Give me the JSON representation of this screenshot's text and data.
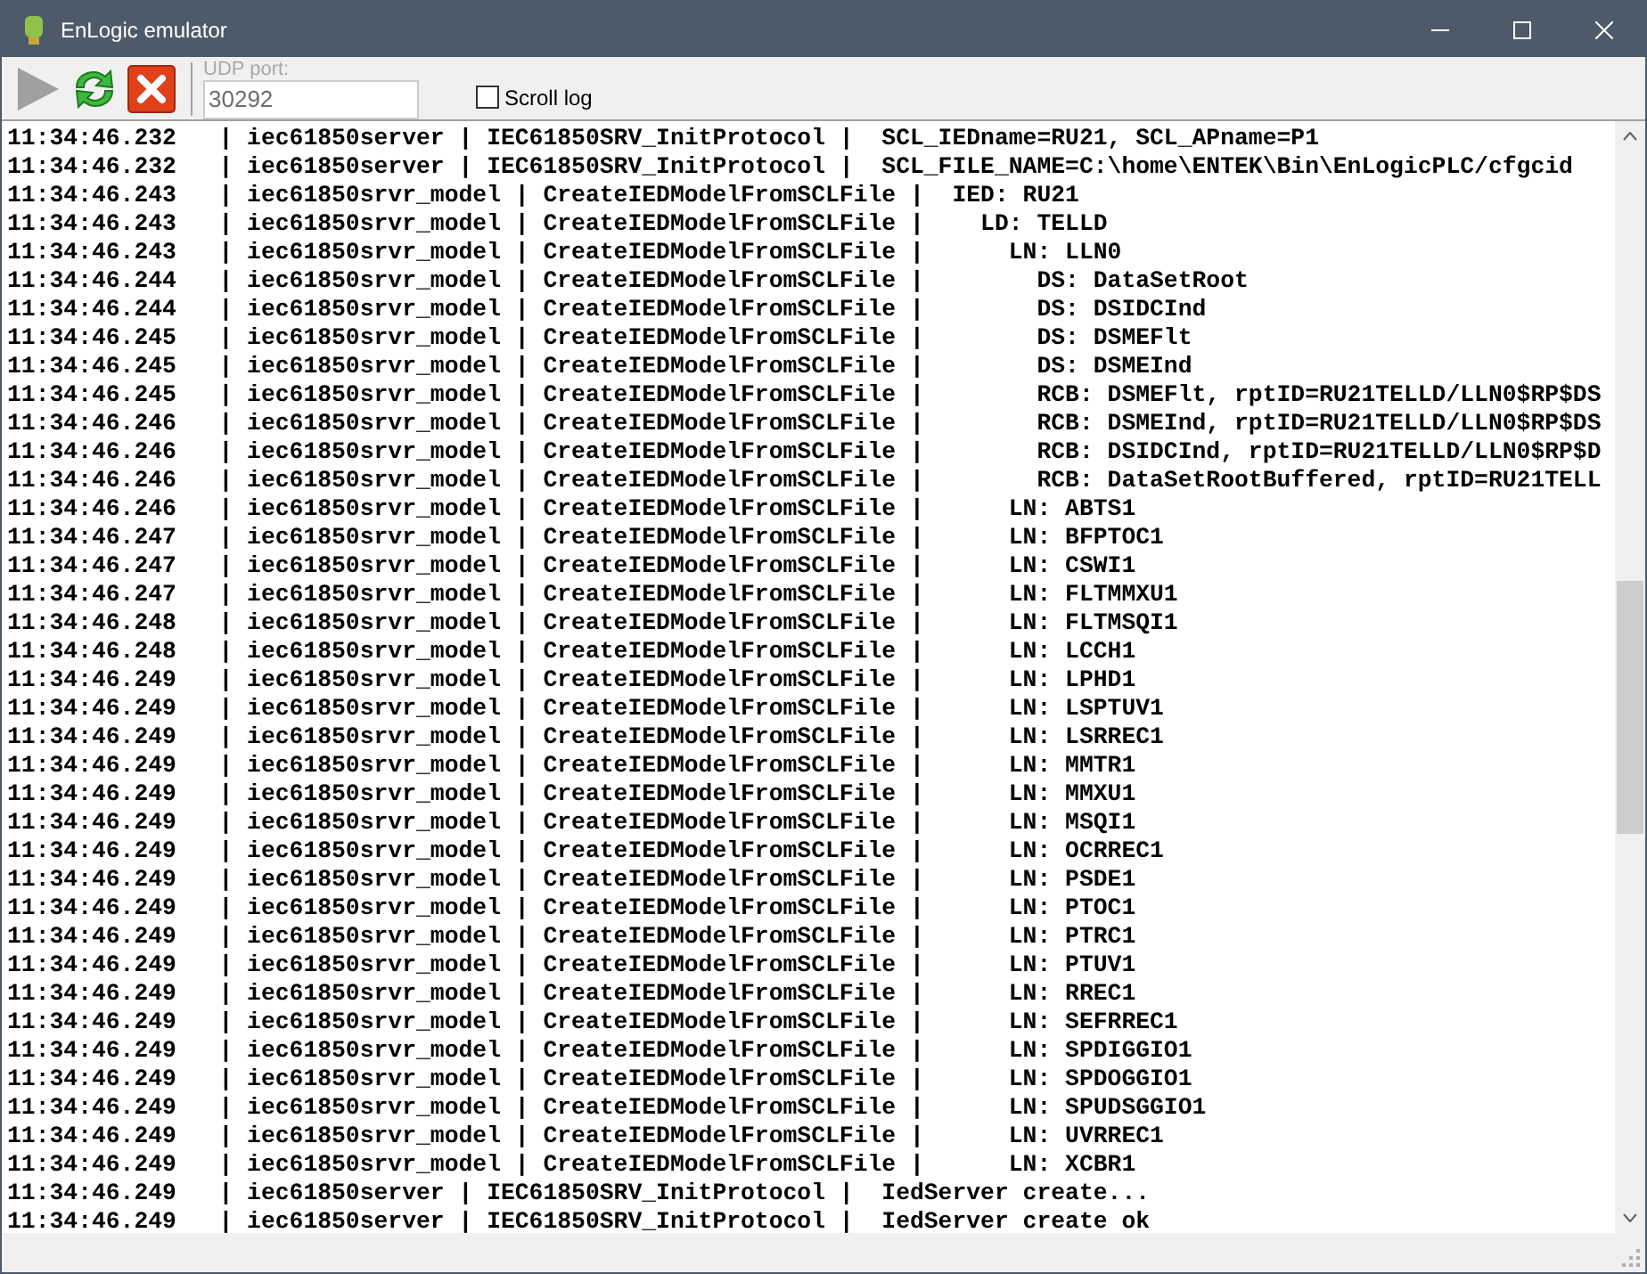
{
  "window": {
    "title": "EnLogic emulator"
  },
  "toolbar": {
    "buttons": [
      {
        "kind": "play",
        "disabled": true
      },
      {
        "kind": "refresh",
        "disabled": false
      },
      {
        "kind": "stop",
        "disabled": false
      }
    ],
    "udp_port": {
      "label": "UDP port:",
      "value": "30292",
      "disabled": true
    },
    "scroll_log": {
      "label": "Scroll log",
      "checked": false
    }
  },
  "log": [
    "11:34:46.232   | iec61850server | IEC61850SRV_InitProtocol |  SCL_IEDname=RU21, SCL_APname=P1",
    "11:34:46.232   | iec61850server | IEC61850SRV_InitProtocol |  SCL_FILE_NAME=C:\\home\\ENTEK\\Bin\\EnLogicPLC/cfgcid",
    "11:34:46.243   | iec61850srvr_model | CreateIEDModelFromSCLFile |  IED: RU21",
    "11:34:46.243   | iec61850srvr_model | CreateIEDModelFromSCLFile |    LD: TELLD",
    "11:34:46.243   | iec61850srvr_model | CreateIEDModelFromSCLFile |      LN: LLN0",
    "11:34:46.244   | iec61850srvr_model | CreateIEDModelFromSCLFile |        DS: DataSetRoot",
    "11:34:46.244   | iec61850srvr_model | CreateIEDModelFromSCLFile |        DS: DSIDCInd",
    "11:34:46.245   | iec61850srvr_model | CreateIEDModelFromSCLFile |        DS: DSMEFlt",
    "11:34:46.245   | iec61850srvr_model | CreateIEDModelFromSCLFile |        DS: DSMEInd",
    "11:34:46.245   | iec61850srvr_model | CreateIEDModelFromSCLFile |        RCB: DSMEFlt, rptID=RU21TELLD/LLN0$RP$DS",
    "11:34:46.246   | iec61850srvr_model | CreateIEDModelFromSCLFile |        RCB: DSMEInd, rptID=RU21TELLD/LLN0$RP$DS",
    "11:34:46.246   | iec61850srvr_model | CreateIEDModelFromSCLFile |        RCB: DSIDCInd, rptID=RU21TELLD/LLN0$RP$D",
    "11:34:46.246   | iec61850srvr_model | CreateIEDModelFromSCLFile |        RCB: DataSetRootBuffered, rptID=RU21TELL",
    "11:34:46.246   | iec61850srvr_model | CreateIEDModelFromSCLFile |      LN: ABTS1",
    "11:34:46.247   | iec61850srvr_model | CreateIEDModelFromSCLFile |      LN: BFPTOC1",
    "11:34:46.247   | iec61850srvr_model | CreateIEDModelFromSCLFile |      LN: CSWI1",
    "11:34:46.247   | iec61850srvr_model | CreateIEDModelFromSCLFile |      LN: FLTMMXU1",
    "11:34:46.248   | iec61850srvr_model | CreateIEDModelFromSCLFile |      LN: FLTMSQI1",
    "11:34:46.248   | iec61850srvr_model | CreateIEDModelFromSCLFile |      LN: LCCH1",
    "11:34:46.249   | iec61850srvr_model | CreateIEDModelFromSCLFile |      LN: LPHD1",
    "11:34:46.249   | iec61850srvr_model | CreateIEDModelFromSCLFile |      LN: LSPTUV1",
    "11:34:46.249   | iec61850srvr_model | CreateIEDModelFromSCLFile |      LN: LSRREC1",
    "11:34:46.249   | iec61850srvr_model | CreateIEDModelFromSCLFile |      LN: MMTR1",
    "11:34:46.249   | iec61850srvr_model | CreateIEDModelFromSCLFile |      LN: MMXU1",
    "11:34:46.249   | iec61850srvr_model | CreateIEDModelFromSCLFile |      LN: MSQI1",
    "11:34:46.249   | iec61850srvr_model | CreateIEDModelFromSCLFile |      LN: OCRREC1",
    "11:34:46.249   | iec61850srvr_model | CreateIEDModelFromSCLFile |      LN: PSDE1",
    "11:34:46.249   | iec61850srvr_model | CreateIEDModelFromSCLFile |      LN: PTOC1",
    "11:34:46.249   | iec61850srvr_model | CreateIEDModelFromSCLFile |      LN: PTRC1",
    "11:34:46.249   | iec61850srvr_model | CreateIEDModelFromSCLFile |      LN: PTUV1",
    "11:34:46.249   | iec61850srvr_model | CreateIEDModelFromSCLFile |      LN: RREC1",
    "11:34:46.249   | iec61850srvr_model | CreateIEDModelFromSCLFile |      LN: SEFRREC1",
    "11:34:46.249   | iec61850srvr_model | CreateIEDModelFromSCLFile |      LN: SPDIGGIO1",
    "11:34:46.249   | iec61850srvr_model | CreateIEDModelFromSCLFile |      LN: SPDOGGIO1",
    "11:34:46.249   | iec61850srvr_model | CreateIEDModelFromSCLFile |      LN: SPUDSGGIO1",
    "11:34:46.249   | iec61850srvr_model | CreateIEDModelFromSCLFile |      LN: UVRREC1",
    "11:34:46.249   | iec61850srvr_model | CreateIEDModelFromSCLFile |      LN: XCBR1",
    "11:34:46.249   | iec61850server | IEC61850SRV_InitProtocol |  IedServer create...",
    "11:34:46.249   | iec61850server | IEC61850SRV_InitProtocol |  IedServer create ok"
  ]
}
